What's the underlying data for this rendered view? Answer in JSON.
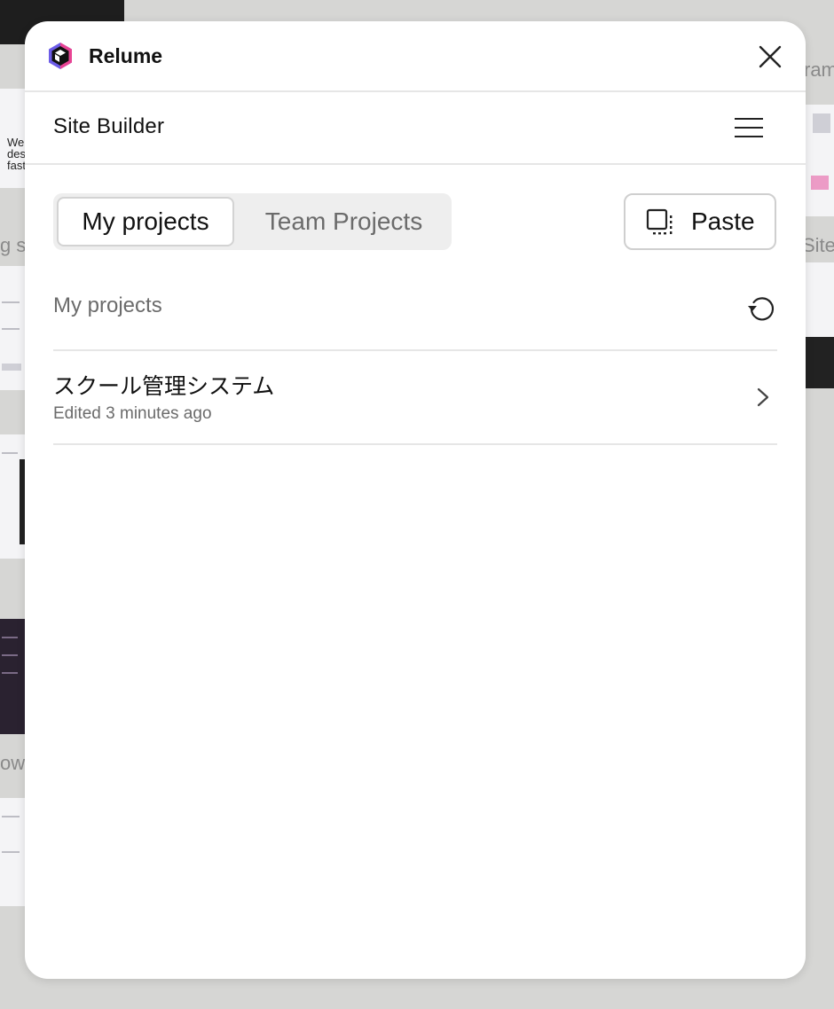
{
  "background": {
    "labels": [
      "ram",
      "g s",
      "Site",
      "ow"
    ],
    "preview_text": [
      "Webs",
      "desi",
      "fast"
    ]
  },
  "app": {
    "name": "Relume",
    "section": "Site Builder"
  },
  "tabs": [
    {
      "label": "My projects",
      "active": true
    },
    {
      "label": "Team Projects",
      "active": false
    }
  ],
  "toolbar": {
    "paste_label": "Paste"
  },
  "list": {
    "heading": "My projects",
    "projects": [
      {
        "name": "スクール管理システム",
        "edited": "Edited 3 minutes ago"
      }
    ]
  },
  "icons": {
    "logo": "relume-logo-icon",
    "close": "close-icon",
    "menu": "hamburger-menu-icon",
    "paste": "paste-icon",
    "refresh": "refresh-icon",
    "chevron": "chevron-right-icon"
  },
  "colors": {
    "panel": "#ffffff",
    "canvas": "#d6d6d4",
    "muted_text": "#6b6b6b",
    "divider": "#e6e6e6"
  }
}
